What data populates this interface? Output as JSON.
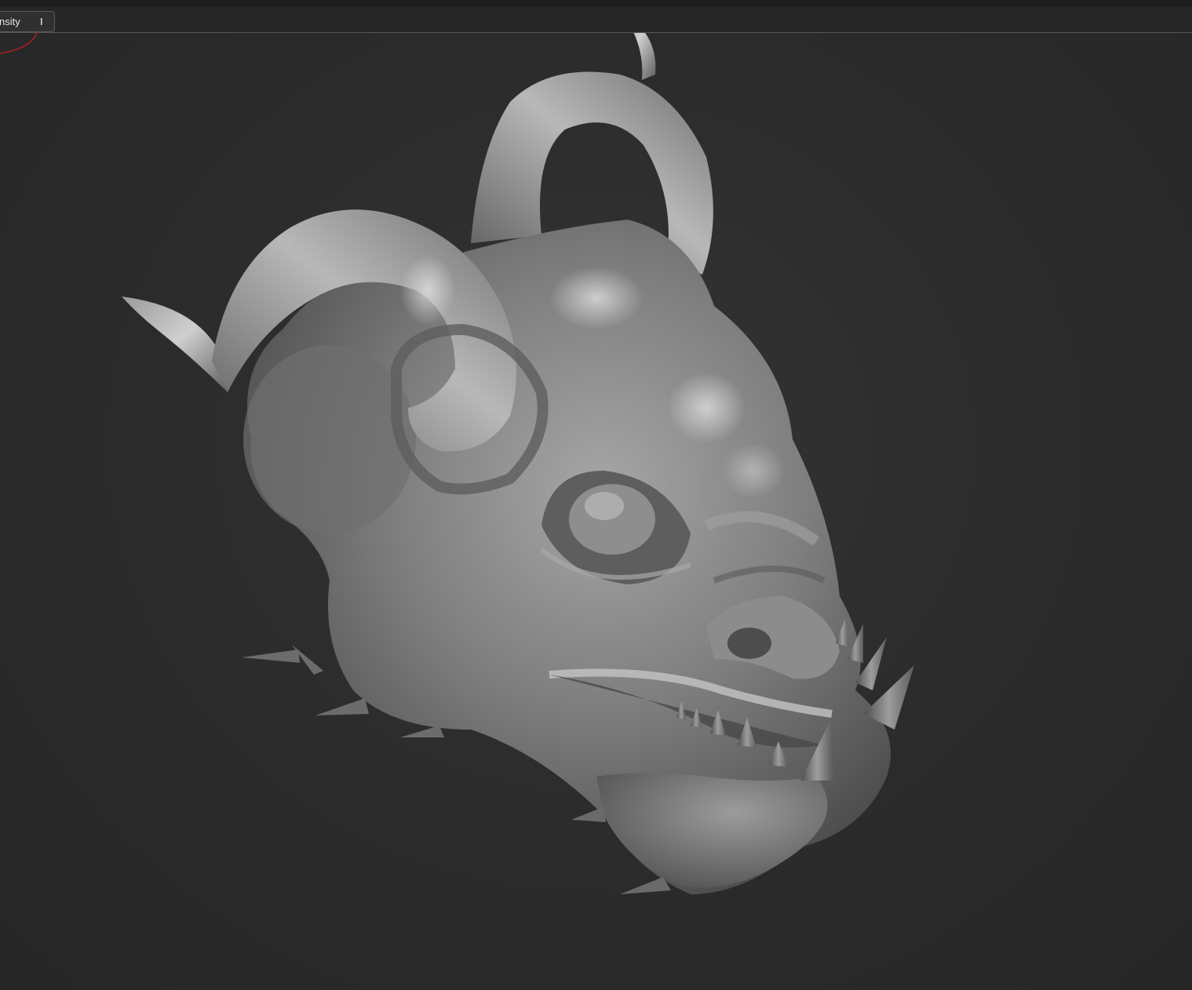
{
  "toolbar": {
    "intensity_label": "nsity",
    "intensity_value": "I"
  },
  "colors": {
    "background": "#2b2b2b",
    "toolbar": "#262626",
    "model_base": "#8a8a8a",
    "brush_ring": "#c0202a"
  },
  "viewport": {
    "model": "demon-head-sculpt"
  }
}
